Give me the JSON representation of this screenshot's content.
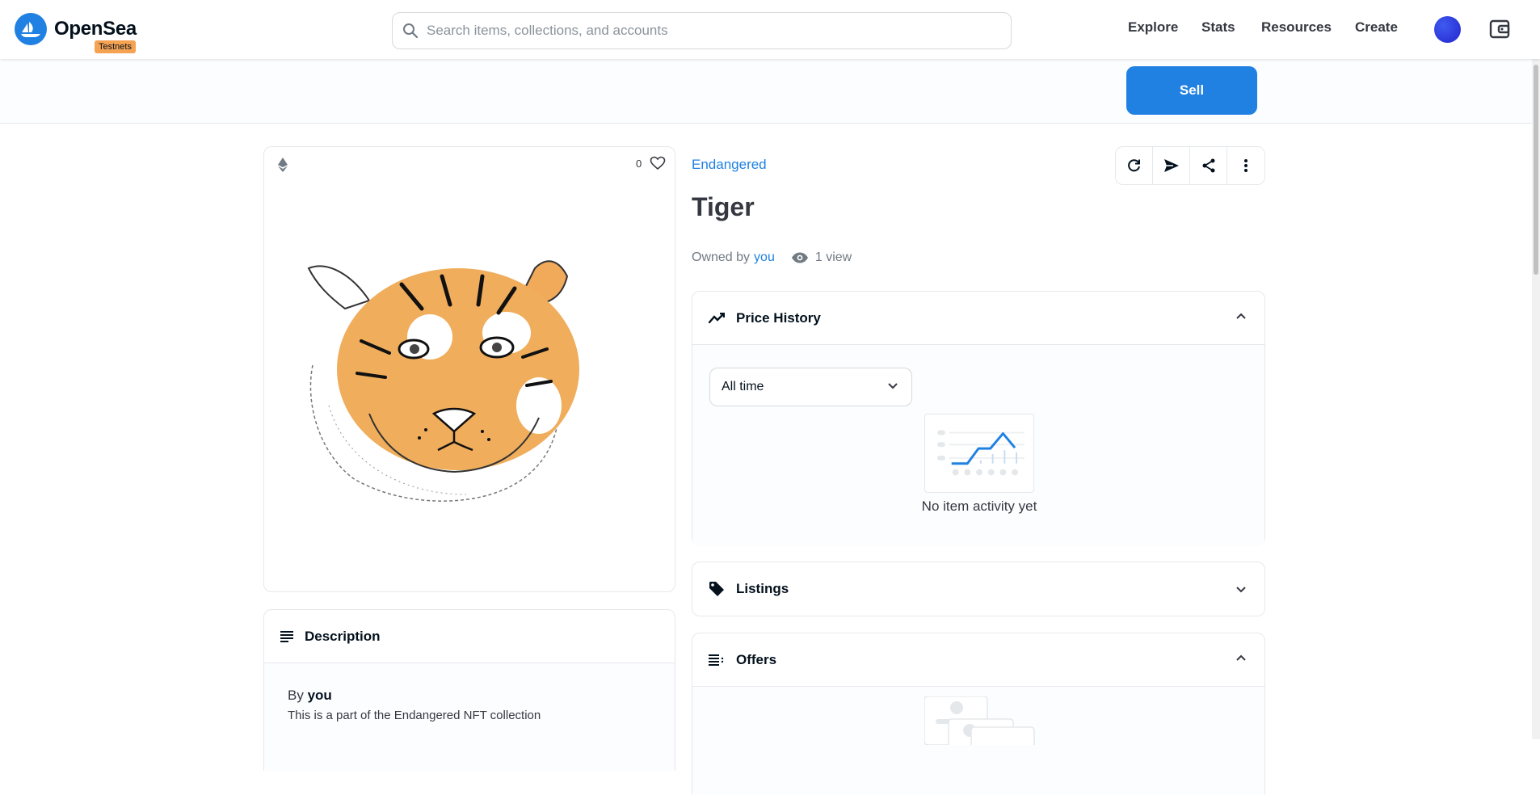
{
  "header": {
    "brand": "OpenSea",
    "badge": "Testnets",
    "search_placeholder": "Search items, collections, and accounts",
    "nav": [
      "Explore",
      "Stats",
      "Resources",
      "Create"
    ]
  },
  "subbar": {
    "sell_label": "Sell"
  },
  "item": {
    "favorites_count": "0",
    "collection": "Endangered",
    "title": "Tiger",
    "owned_by_label": "Owned by",
    "owner": "you",
    "views": "1 view"
  },
  "description": {
    "heading": "Description",
    "by_label": "By",
    "by_name": "you",
    "text": "This is a part of the Endangered NFT collection"
  },
  "price_history": {
    "heading": "Price History",
    "period": "All time",
    "empty": "No item activity yet"
  },
  "listings": {
    "heading": "Listings"
  },
  "offers": {
    "heading": "Offers"
  },
  "colors": {
    "accent": "#2081e2",
    "badge": "#f5a352",
    "text": "#04111d"
  }
}
